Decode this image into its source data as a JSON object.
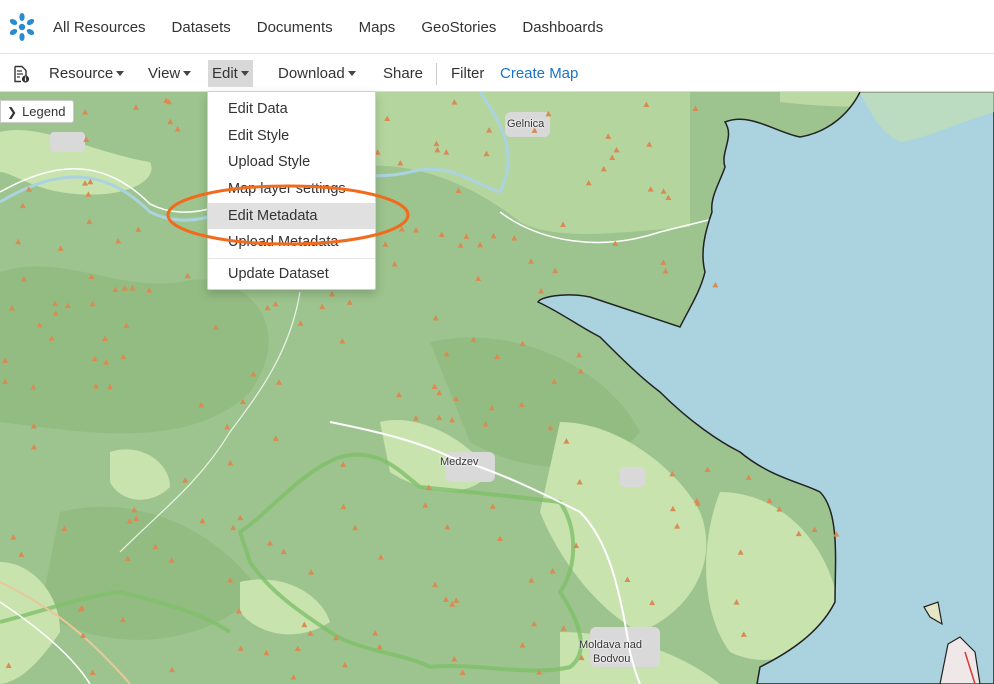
{
  "brand": {
    "logo_icon": "geonode-logo-icon",
    "accent": "#2a8ccf"
  },
  "topnav": {
    "items": [
      {
        "label": "All Resources"
      },
      {
        "label": "Datasets"
      },
      {
        "label": "Documents"
      },
      {
        "label": "Maps"
      },
      {
        "label": "GeoStories"
      },
      {
        "label": "Dashboards"
      }
    ]
  },
  "toolbar": {
    "dataset_icon": "dataset-info-icon",
    "resource": "Resource",
    "view": "View",
    "edit": "Edit",
    "download": "Download",
    "share": "Share",
    "filter": "Filter",
    "create_map": "Create Map"
  },
  "legend": {
    "label": "Legend"
  },
  "edit_menu": {
    "items": [
      {
        "label": "Edit Data"
      },
      {
        "label": "Edit Style"
      },
      {
        "label": "Upload Style"
      },
      {
        "label": "Map layer settings"
      },
      {
        "label": "Edit Metadata",
        "highlighted": true
      },
      {
        "label": "Upload Metadata"
      },
      {
        "label": "Update Dataset"
      }
    ]
  },
  "map": {
    "labels": {
      "gelnica": "Gelnica",
      "medzev": "Medzev",
      "moldava_1": "Moldava nad",
      "moldava_2": "Bodvou"
    },
    "colors": {
      "forest": "#9dc48e",
      "meadow": "#cde8b2",
      "water": "#aad3df",
      "urban": "#e0dfdf",
      "peak": "#d98b53"
    }
  },
  "annotation": {
    "color": "#f26a1b"
  }
}
